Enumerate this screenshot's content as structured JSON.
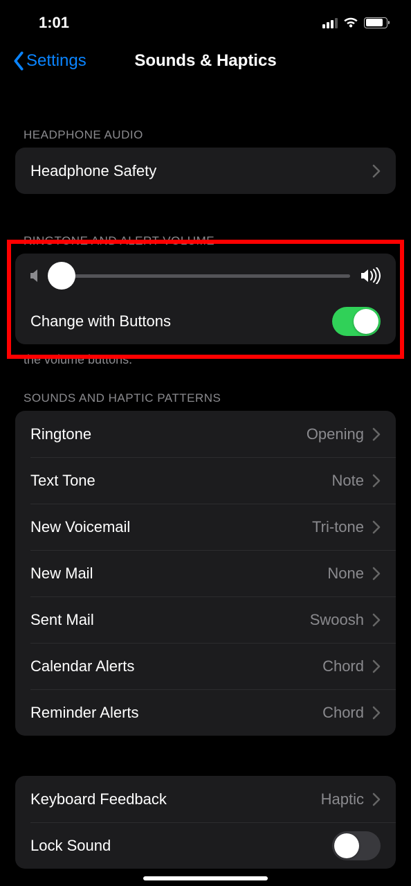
{
  "status": {
    "time": "1:01"
  },
  "nav": {
    "back_label": "Settings",
    "title": "Sounds & Haptics"
  },
  "sections": {
    "headphone": {
      "header": "HEADPHONE AUDIO",
      "safety_label": "Headphone Safety"
    },
    "ringtone_volume": {
      "header": "RINGTONE AND ALERT VOLUME",
      "change_with_buttons_label": "Change with Buttons",
      "change_with_buttons_on": true,
      "footer_visible": "the volume buttons.",
      "slider_value_percent": 3
    },
    "patterns": {
      "header": "SOUNDS AND HAPTIC PATTERNS",
      "items": [
        {
          "label": "Ringtone",
          "value": "Opening"
        },
        {
          "label": "Text Tone",
          "value": "Note"
        },
        {
          "label": "New Voicemail",
          "value": "Tri-tone"
        },
        {
          "label": "New Mail",
          "value": "None"
        },
        {
          "label": "Sent Mail",
          "value": "Swoosh"
        },
        {
          "label": "Calendar Alerts",
          "value": "Chord"
        },
        {
          "label": "Reminder Alerts",
          "value": "Chord"
        }
      ]
    },
    "misc": {
      "keyboard_feedback_label": "Keyboard Feedback",
      "keyboard_feedback_value": "Haptic",
      "lock_sound_label": "Lock Sound",
      "lock_sound_on": false
    }
  }
}
